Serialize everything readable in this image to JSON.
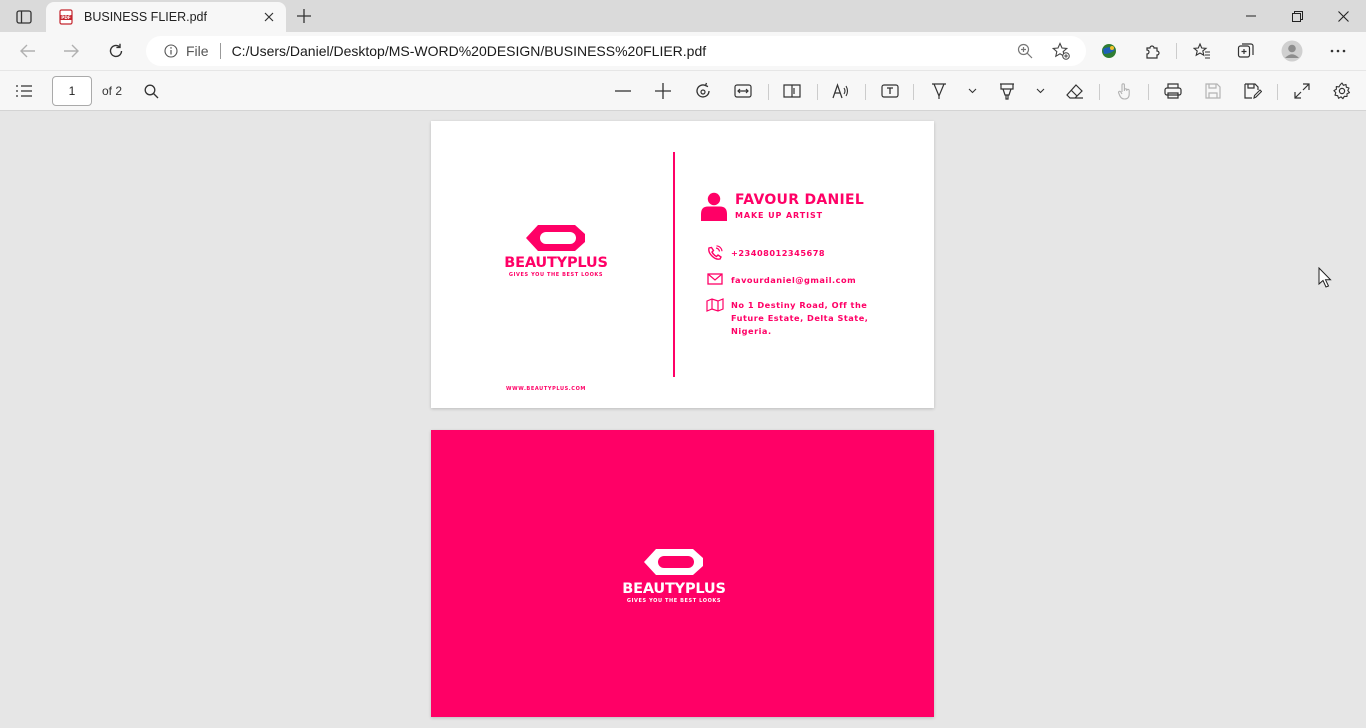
{
  "browser": {
    "tab_title": "BUSINESS FLIER.pdf",
    "address_scheme": "File",
    "url": "C:/Users/Daniel/Desktop/MS-WORD%20DESIGN/BUSINESS%20FLIER.pdf"
  },
  "pdf_toolbar": {
    "page_number": "1",
    "page_count": "of 2"
  },
  "card_front": {
    "brand": "BEAUTYPLUS",
    "tagline": "GIVES YOU THE BEST LOOKS",
    "website": "WWW.BEAUTYPLUS.COM",
    "name": "FAVOUR DANIEL",
    "role": "MAKE UP ARTIST",
    "phone": "+23408012345678",
    "email": "favourdaniel@gmail.com",
    "address_line1": "No 1 Destiny Road, Off the",
    "address_line2": "Future Estate, Delta State,",
    "address_line3": "Nigeria."
  },
  "card_back": {
    "brand": "BEAUTYPLUS",
    "tagline": "GIVES YOU THE BEST LOOKS"
  },
  "colors": {
    "accent": "#ff0066",
    "page_white": "#ffffff",
    "viewer_background": "#e6e6e6",
    "chrome_background": "#f7f7f7"
  },
  "icons": {
    "tab_actions": "tab-actions-icon",
    "pdf": "pdf-file-icon",
    "close": "close-icon",
    "new_tab": "plus-icon",
    "back": "back-arrow-icon",
    "forward": "forward-arrow-icon",
    "refresh": "refresh-icon",
    "info": "info-icon",
    "zoom": "zoom-icon",
    "favorite_add": "star-add-icon",
    "extensions": "puzzle-icon",
    "favorites": "favorites-icon",
    "collections": "collections-icon",
    "profile": "avatar",
    "more": "more-icon",
    "contents": "contents-list-icon",
    "search": "search-icon",
    "zoom_out": "minus-icon",
    "zoom_in": "plus-icon",
    "rotate": "rotate-icon",
    "fit": "fit-width-icon",
    "page_view": "page-view-icon",
    "read_aloud": "read-aloud-icon",
    "text": "add-text-icon",
    "draw": "draw-icon",
    "highlight": "highlight-icon",
    "erase": "eraser-icon",
    "touch": "touch-icon",
    "print": "print-icon",
    "save": "save-icon",
    "save_as": "save-as-icon",
    "fullscreen": "fullscreen-icon",
    "settings": "gear-icon",
    "phone": "phone-icon",
    "mail": "mail-icon",
    "map": "map-icon",
    "person": "person-icon"
  }
}
